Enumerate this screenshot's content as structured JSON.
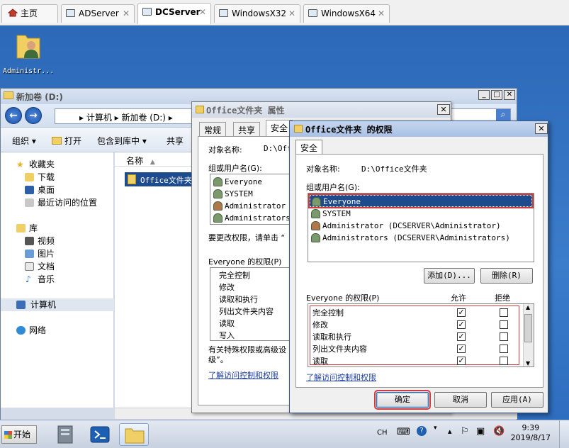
{
  "host_tabs": [
    {
      "label": "主页",
      "active": false
    },
    {
      "label": "ADServer",
      "active": false
    },
    {
      "label": "DCServer",
      "active": true
    },
    {
      "label": "WindowsX32",
      "active": false
    },
    {
      "label": "WindowsX64",
      "active": false
    }
  ],
  "desktop": {
    "icon_label": "Administr..."
  },
  "explorer": {
    "title": "新加卷 (D:)",
    "address": "▸ 计算机 ▸ 新加卷 (D:) ▸",
    "toolbar": {
      "organize": "组织 ▾",
      "open": "打开",
      "include": "包含到库中 ▾",
      "share": "共享"
    },
    "nav": {
      "favorites": "收藏夹",
      "downloads": "下载",
      "desktop": "桌面",
      "recent": "最近访问的位置",
      "libraries": "库",
      "videos": "视频",
      "pictures": "图片",
      "documents": "文档",
      "music": "音乐",
      "computer": "计算机",
      "network": "网络"
    },
    "column_name": "名称",
    "file_item": "Office文件夹"
  },
  "props": {
    "title": "Office文件夹 属性",
    "tabs": [
      "常规",
      "共享",
      "安全"
    ],
    "object_label": "对象名称:",
    "object_value": "D:\\Off",
    "group_label": "组或用户名(G):",
    "users": [
      "Everyone",
      "SYSTEM",
      "Administrator (",
      "Administrators"
    ],
    "change_hint": "要更改权限，请单击 “",
    "perm_label": "Everyone 的权限(P)",
    "perms": [
      "完全控制",
      "修改",
      "读取和执行",
      "列出文件夹内容",
      "读取",
      "写入"
    ],
    "special_hint_1": "有关特殊权限或高级设",
    "special_hint_2": "级”。",
    "link": "了解访问控制和权限"
  },
  "perm": {
    "title": "Office文件夹 的权限",
    "tab": "安全",
    "object_label": "对象名称:",
    "object_value": "D:\\Office文件夹",
    "group_label": "组或用户名(G):",
    "users": [
      {
        "name": "Everyone",
        "selected": true
      },
      {
        "name": "SYSTEM",
        "selected": false
      },
      {
        "name": "Administrator (DCSERVER\\Administrator)",
        "selected": false
      },
      {
        "name": "Administrators (DCSERVER\\Administrators)",
        "selected": false
      }
    ],
    "add_button": "添加(D)...",
    "remove_button": "删除(R)",
    "perm_label": "Everyone 的权限(P)",
    "allow_header": "允许",
    "deny_header": "拒绝",
    "permissions": [
      {
        "name": "完全控制",
        "allow": true,
        "deny": false
      },
      {
        "name": "修改",
        "allow": true,
        "deny": false
      },
      {
        "name": "读取和执行",
        "allow": true,
        "deny": false
      },
      {
        "name": "列出文件夹内容",
        "allow": true,
        "deny": false
      },
      {
        "name": "读取",
        "allow": true,
        "deny": false
      }
    ],
    "link": "了解访问控制和权限",
    "ok_button": "确定",
    "cancel_button": "取消",
    "apply_button": "应用(A)",
    "highlight_color": "#d23a3a"
  },
  "taskbar": {
    "start": "开始",
    "ime": "CH",
    "time": "9:39",
    "date": "2019/8/17"
  }
}
